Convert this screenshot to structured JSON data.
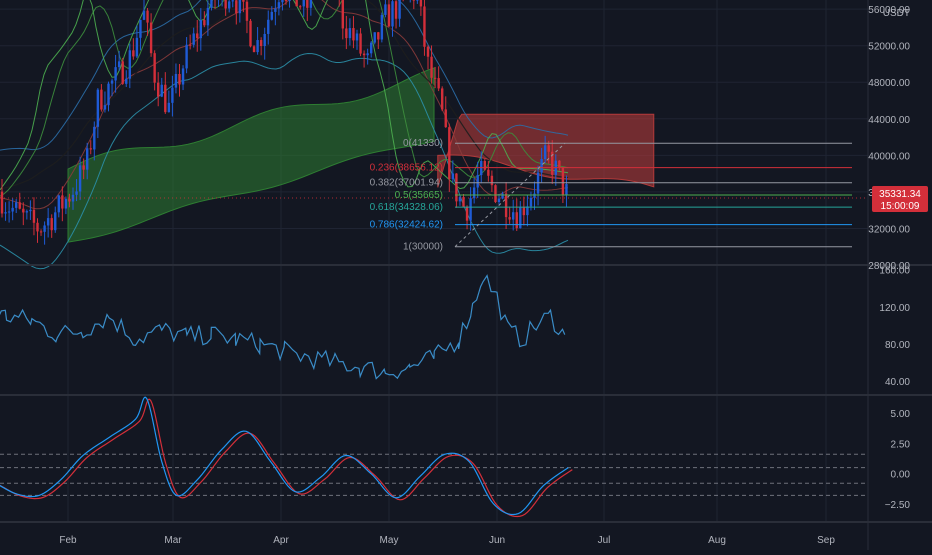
{
  "colors": {
    "bg": "#131722",
    "grid": "#1f2433",
    "separator": "#2a2e39",
    "axis_text": "#b2b5be",
    "candle_up": "#1f5bd6",
    "candle_down": "#d32f3a",
    "kumo_bull": "#2e7d32",
    "kumo_bear": "#b33a3a",
    "fib_red": "#d32f3a",
    "fib_green": "#4caf50",
    "fib_teal": "#26a69a",
    "fib_blue": "#2196f3",
    "fib_gray": "#9598a1",
    "price_badge": "#d32f3a",
    "cci": "#3a8cc7",
    "osc_fast": "#2196f3",
    "osc_slow": "#d32f3a"
  },
  "price_axis": {
    "currency": "USDT",
    "ticks": [
      "56000.00",
      "52000.00",
      "48000.00",
      "44000.00",
      "40000.00",
      "36000.00",
      "32000.00",
      "28000.00"
    ]
  },
  "price_badge": {
    "price": "35331.34",
    "countdown": "15:00:09"
  },
  "fib_levels": [
    {
      "label": "0(41330)",
      "price": 41330,
      "color_key": "fib_gray"
    },
    {
      "label": "0.236(38656.12)",
      "price": 38656.12,
      "color_key": "fib_red"
    },
    {
      "label": "0.382(37001.94)",
      "price": 37001.94,
      "color_key": "fib_gray"
    },
    {
      "label": "0.5(35665)",
      "price": 35665,
      "color_key": "fib_green"
    },
    {
      "label": "0.618(34328.06)",
      "price": 34328.06,
      "color_key": "fib_teal"
    },
    {
      "label": "0.786(32424.62)",
      "price": 32424.62,
      "color_key": "fib_blue"
    },
    {
      "label": "1(30000)",
      "price": 30000,
      "color_key": "fib_gray"
    }
  ],
  "cci_axis": {
    "ticks": [
      "160.00",
      "120.00",
      "80.00",
      "40.00"
    ]
  },
  "osc_axis": {
    "ticks": [
      "5.00",
      "2.50",
      "0.00",
      "−2.50"
    ]
  },
  "time_axis": {
    "labels": [
      "Feb",
      "Mar",
      "Apr",
      "May",
      "Jun",
      "Jul",
      "Aug",
      "Sep"
    ]
  },
  "chart_data": [
    {
      "type": "line",
      "panel": "price",
      "description_series": [
        "candles",
        "ichimoku",
        "bollinger",
        "fibonacci"
      ],
      "ylim": [
        28000,
        57000
      ],
      "price_path": [
        [
          "Jan 1",
          34000
        ],
        [
          "Jan 6",
          37000
        ],
        [
          "Jan 10",
          40000
        ],
        [
          "Jan 14",
          35000
        ],
        [
          "Jan 20",
          33000
        ],
        [
          "Jan 24",
          32000
        ],
        [
          "Jan 28",
          33500
        ],
        [
          "Feb 2",
          36000
        ],
        [
          "Feb 6",
          39000
        ],
        [
          "Feb 9",
          46000
        ],
        [
          "Feb 14",
          48500
        ],
        [
          "Feb 18",
          51000
        ],
        [
          "Feb 21",
          56000
        ],
        [
          "Feb 24",
          49000
        ],
        [
          "Feb 28",
          45000
        ],
        [
          "Mar 4",
          50000
        ],
        [
          "Mar 12",
          57000
        ],
        [
          "Mar 18",
          58000
        ],
        [
          "Mar 25",
          52000
        ],
        [
          "Apr 1",
          58500
        ],
        [
          "Apr 8",
          56000
        ],
        [
          "Apr 14",
          63000
        ],
        [
          "Apr 18",
          55000
        ],
        [
          "Apr 25",
          50000
        ],
        [
          "Apr 30",
          55000
        ],
        [
          "May 5",
          57000
        ],
        [
          "May 9",
          58000
        ],
        [
          "May 12",
          50000
        ],
        [
          "May 16",
          45000
        ],
        [
          "May 19",
          37000
        ],
        [
          "May 23",
          34000
        ],
        [
          "May 27",
          38000
        ],
        [
          "Jun 1",
          36000
        ],
        [
          "Jun 7",
          33500
        ],
        [
          "Jun 12",
          37000
        ],
        [
          "Jun 15",
          40000
        ],
        [
          "Jun 18",
          38000
        ],
        [
          "Jun 21",
          35331
        ]
      ],
      "cloud_bear": {
        "x_range": [
          "May 15",
          "Jul 15"
        ],
        "top": 44500,
        "bottom_start": 40000,
        "bottom_end": 36300
      },
      "cloud_bull": {
        "x_range": [
          "Feb 1",
          "May 15"
        ],
        "top_start": 38500,
        "top_end": 49000,
        "bottom_start": 30500,
        "bottom_end": 42000
      }
    },
    {
      "type": "line",
      "panel": "cci",
      "ylim": [
        25,
        165
      ],
      "x": [
        "Jan 1",
        "Jan 8",
        "Jan 15",
        "Jan 22",
        "Jan 29",
        "Feb 5",
        "Feb 12",
        "Feb 19",
        "Feb 26",
        "Mar 5",
        "Mar 12",
        "Mar 19",
        "Mar 26",
        "Apr 2",
        "Apr 9",
        "Apr 16",
        "Apr 23",
        "Apr 30",
        "May 7",
        "May 14",
        "May 21",
        "May 25",
        "May 28",
        "Jun 1",
        "Jun 4",
        "Jun 8",
        "Jun 12",
        "Jun 16",
        "Jun 20"
      ],
      "values": [
        110,
        115,
        110,
        105,
        90,
        95,
        110,
        85,
        95,
        88,
        90,
        85,
        80,
        72,
        65,
        60,
        55,
        50,
        55,
        65,
        85,
        120,
        155,
        130,
        95,
        85,
        100,
        110,
        90
      ]
    },
    {
      "type": "line",
      "panel": "oscillator",
      "ylim": [
        -4,
        6.5
      ],
      "levels": [
        1.6,
        0.5,
        -0.8,
        -1.8
      ],
      "x": [
        "Jan 1",
        "Jan 6",
        "Jan 12",
        "Jan 18",
        "Jan 24",
        "Jan 30",
        "Feb 5",
        "Feb 12",
        "Feb 19",
        "Feb 22",
        "Feb 26",
        "Mar 2",
        "Mar 8",
        "Mar 15",
        "Mar 22",
        "Mar 29",
        "Apr 5",
        "Apr 12",
        "Apr 19",
        "Apr 26",
        "May 3",
        "May 10",
        "May 17",
        "May 24",
        "May 31",
        "Jun 7",
        "Jun 14",
        "Jun 21"
      ],
      "values": [
        1.2,
        0.2,
        -0.8,
        -1.7,
        -1.8,
        -0.5,
        1.5,
        3.0,
        4.5,
        6.2,
        1.0,
        -1.8,
        -0.5,
        2.0,
        3.5,
        1.0,
        -1.5,
        -0.3,
        1.5,
        0.0,
        -2.0,
        -0.2,
        1.6,
        1.0,
        -2.5,
        -3.3,
        -1.0,
        0.5
      ]
    }
  ]
}
